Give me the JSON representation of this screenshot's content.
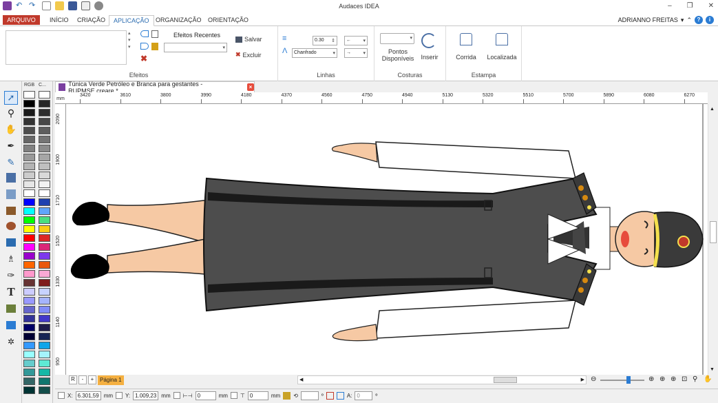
{
  "window": {
    "title": "Audaces IDEA"
  },
  "menu": {
    "file": "ARQUIVO",
    "tabs": [
      "INÍCIO",
      "CRIAÇÃO",
      "APLICAÇÃO",
      "ORGANIZAÇÃO",
      "ORIENTAÇÃO"
    ],
    "active_tab": "APLICAÇÃO",
    "user": "ADRIANNO FREITAS"
  },
  "ribbon": {
    "efeitos": {
      "recent_label": "Efeitos Recentes",
      "save": "Salvar",
      "delete": "Excluir",
      "group": "Efeitos"
    },
    "linhas": {
      "width": "0.30",
      "corner": "Chanfrado",
      "group": "Linhas"
    },
    "costuras": {
      "points": "Pontos Disponíveis",
      "insert": "Inserir",
      "group": "Costuras"
    },
    "estampa": {
      "run": "Corrida",
      "located": "Localizada",
      "group": "Estampa"
    }
  },
  "palette": {
    "header_rgb": "RGB",
    "header_c": "C...",
    "colors_left": [
      "#ffffff",
      "#000000",
      "#1a1a1a",
      "#333333",
      "#4d4d4d",
      "#666666",
      "#808080",
      "#999999",
      "#b3b3b3",
      "#cccccc",
      "#e6e6e6",
      "#ffffff",
      "#0000ff",
      "#00ffff",
      "#00ff00",
      "#ffff00",
      "#ff0000",
      "#ff00ff",
      "#9900cc",
      "#ff6600",
      "#ff99cc",
      "#663333",
      "#ccccff",
      "#9999ff",
      "#6666cc",
      "#333399",
      "#000066",
      "#000033",
      "#3399ff",
      "#99ffff",
      "#66cccc",
      "#339999",
      "#336666",
      "#003333"
    ],
    "colors_right": [
      "#ffffff",
      "#262626",
      "#2d2d2d",
      "#474747",
      "#5e5e5e",
      "#757575",
      "#8c8c8c",
      "#a6a6a6",
      "#bfbfbf",
      "#d9d9d9",
      "#f2f2f2",
      "#ffffff",
      "#1e40af",
      "#60a5fa",
      "#4ade80",
      "#facc15",
      "#dc2626",
      "#db2777",
      "#7c3aed",
      "#ea580c",
      "#f9a8d4",
      "#7f1d1d",
      "#c7d2fe",
      "#a5b4fc",
      "#818cf8",
      "#4338ca",
      "#1e1b4b",
      "#172554",
      "#0ea5e9",
      "#a5f3fc",
      "#5eead4",
      "#14b8a6",
      "#0f766e",
      "#134e4a"
    ]
  },
  "document": {
    "tab_title": "Túnica Verde Petróleo e Branca para gestantes - RUPMSE.creare *",
    "unit": "mm",
    "hruler": [
      "3420",
      "3610",
      "3800",
      "3990",
      "4180",
      "4370",
      "4560",
      "4750",
      "4940",
      "5130",
      "5320",
      "5510",
      "5700",
      "5890",
      "6080",
      "6270"
    ],
    "vruler": [
      "2090",
      "1900",
      "1710",
      "1520",
      "1330",
      "1140",
      "950"
    ]
  },
  "pages": {
    "r": "R",
    "minus": "-",
    "plus": "+",
    "page": "Página 1"
  },
  "status": {
    "x_label": "X:",
    "x_value": "6.301,59",
    "y_label": "Y:",
    "y_value": "1.009,23",
    "unit": "mm",
    "w_value": "0",
    "h_value": "0",
    "angle_label": "A:",
    "angle_value": "0",
    "deg": "º"
  }
}
